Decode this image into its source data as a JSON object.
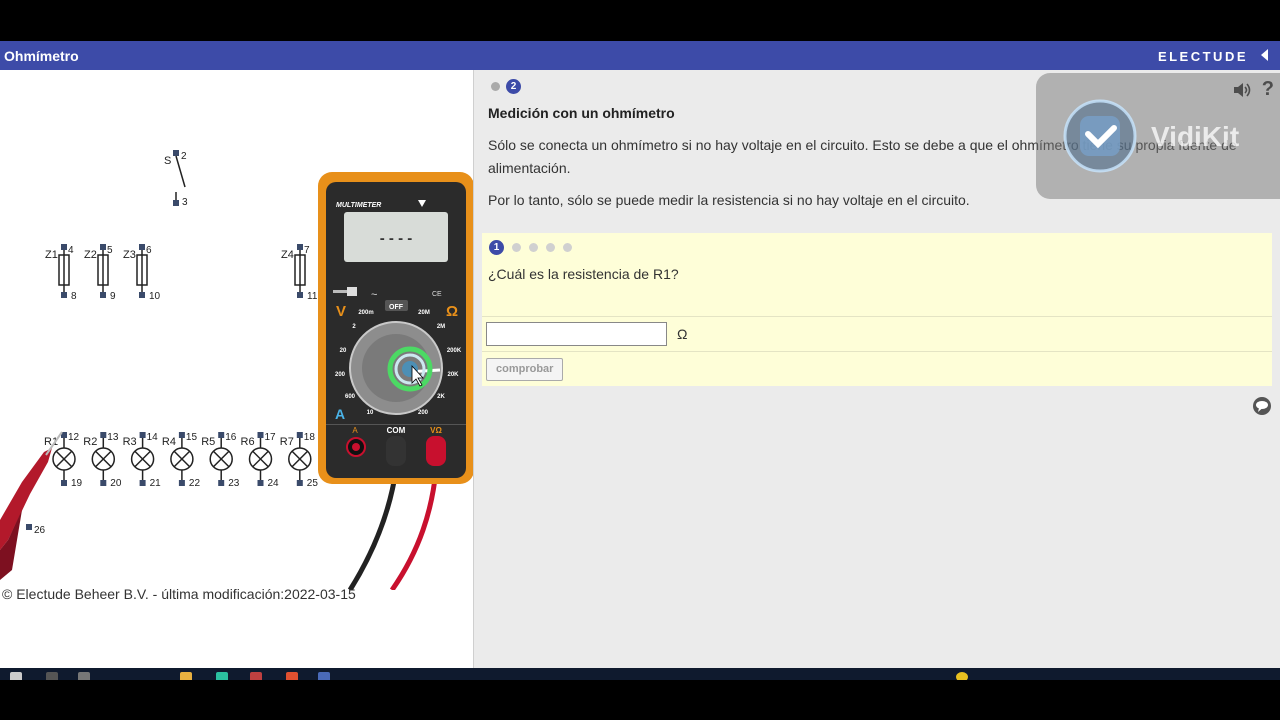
{
  "app": {
    "title": "Ohmímetro",
    "brand": "ELECTUDE"
  },
  "lesson": {
    "current_step": "2",
    "title": "Medición con un ohmímetro",
    "paragraph1": "Sólo se conecta un ohmímetro si no hay voltaje en el circuito. Esto se debe a que el ohmímetro tiene su propia fuente de alimentación.",
    "paragraph2": "Por lo tanto, sólo se puede medir la resistencia si no hay voltaje en el circuito."
  },
  "question": {
    "current_step": "1",
    "text": "¿Cuál es la resistencia de R1?",
    "answer_value": "",
    "unit": "Ω",
    "check_label": "comprobar"
  },
  "circuit": {
    "switch": {
      "label": "S",
      "pin_top": "2",
      "pin_bottom": "3"
    },
    "fuses": [
      {
        "label": "Z1",
        "pin_top": "4",
        "pin_bottom": "8"
      },
      {
        "label": "Z2",
        "pin_top": "5",
        "pin_bottom": "9"
      },
      {
        "label": "Z3",
        "pin_top": "6",
        "pin_bottom": "10"
      },
      {
        "label": "Z4",
        "pin_top": "7",
        "pin_bottom": "11"
      }
    ],
    "lamps": [
      {
        "label": "R1",
        "pin_top": "12",
        "pin_bottom": "19"
      },
      {
        "label": "R2",
        "pin_top": "13",
        "pin_bottom": "20"
      },
      {
        "label": "R3",
        "pin_top": "14",
        "pin_bottom": "21"
      },
      {
        "label": "R4",
        "pin_top": "15",
        "pin_bottom": "22"
      },
      {
        "label": "R5",
        "pin_top": "16",
        "pin_bottom": "23"
      },
      {
        "label": "R6",
        "pin_top": "17",
        "pin_bottom": "24"
      },
      {
        "label": "R7",
        "pin_top": "18",
        "pin_bottom": "25"
      }
    ],
    "ground_pin": "26"
  },
  "multimeter": {
    "brand": "MULTIMETER",
    "display": "- - - -",
    "off_label": "OFF",
    "v_label": "V",
    "ohm_label": "Ω",
    "a_label": "A",
    "com_label": "COM",
    "vohm_label": "VΩ",
    "a_jack_label": "A",
    "ranges": [
      "200m",
      "2",
      "20",
      "200",
      "600",
      "10",
      "200",
      "2K",
      "20K",
      "200K",
      "2M",
      "20M"
    ],
    "probe_black_color": "#222222",
    "probe_red_color": "#c8102e",
    "body_color": "#e8901a"
  },
  "footer": {
    "copyright": "© Electude Beheer B.V. - última modificación:2022-03-15"
  },
  "watermark": {
    "text": "VidiKit"
  },
  "icons": {
    "collapse": "chevron-left-icon",
    "sound": "speaker-icon",
    "help": "question-icon",
    "comment": "comment-icon"
  },
  "colors": {
    "accent": "#3d4ba8",
    "question_bg": "#fefed8",
    "content_bg": "#ebebeb"
  }
}
